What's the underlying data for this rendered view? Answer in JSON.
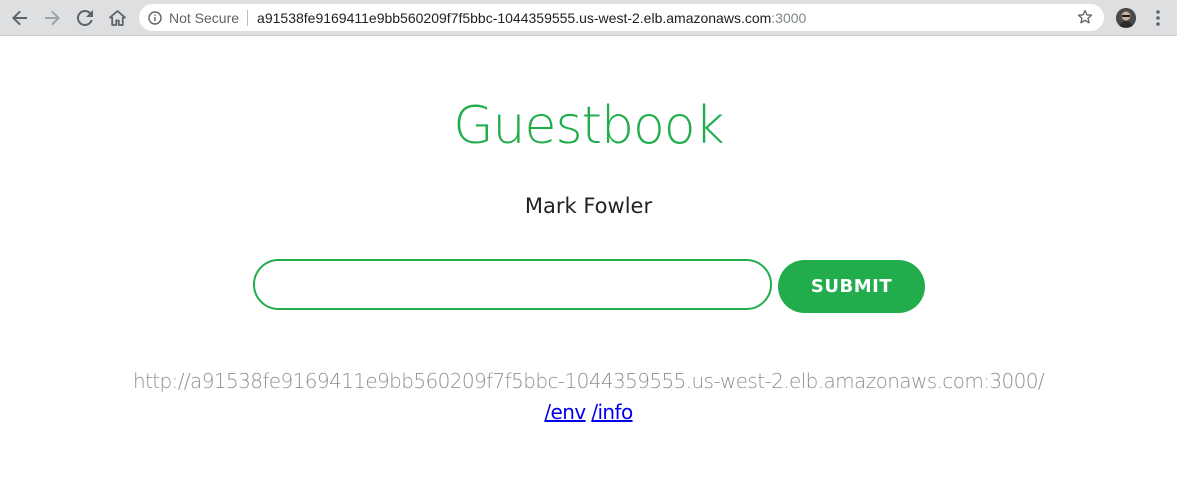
{
  "browser": {
    "security_label": "Not Secure",
    "url_host": "a91538fe9169411e9bb560209f7f5bbc-1044359555.us-west-2.elb.amazonaws.com",
    "url_port": ":3000",
    "icons": [
      "back-arrow-icon",
      "forward-arrow-icon",
      "reload-icon",
      "home-icon",
      "info-icon",
      "star-icon",
      "profile-avatar",
      "kebab-menu-icon"
    ]
  },
  "page": {
    "title": "Guestbook",
    "entries": [
      "Mark Fowler"
    ],
    "form": {
      "input_value": "",
      "input_placeholder": "",
      "submit_label": "SUBMIT"
    },
    "host_url": "http://a91538fe9169411e9bb560209f7f5bbc-1044359555.us-west-2.elb.amazonaws.com:3000/",
    "links": [
      {
        "label": "/env"
      },
      {
        "label": "/info"
      }
    ]
  },
  "colors": {
    "accent": "#21ad4c",
    "link": "#0000ee",
    "muted_text": "#8f8f8f"
  }
}
